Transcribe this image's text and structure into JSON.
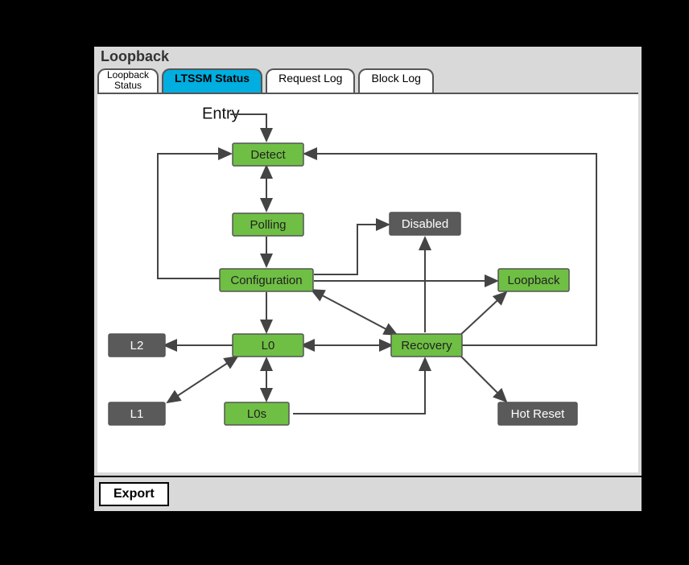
{
  "window": {
    "title": "Loopback"
  },
  "tabs": [
    {
      "label_line1": "Loopback",
      "label_line2": "Status",
      "active": false
    },
    {
      "label": "LTSSM Status",
      "active": true
    },
    {
      "label": "Request Log",
      "active": false
    },
    {
      "label": "Block Log",
      "active": false
    }
  ],
  "footer": {
    "export_label": "Export"
  },
  "diagram": {
    "entry_label": "Entry",
    "nodes": {
      "detect": {
        "label": "Detect",
        "color": "green"
      },
      "polling": {
        "label": "Polling",
        "color": "green"
      },
      "configuration": {
        "label": "Configuration",
        "color": "green"
      },
      "l0": {
        "label": "L0",
        "color": "green"
      },
      "l0s": {
        "label": "L0s",
        "color": "green"
      },
      "recovery": {
        "label": "Recovery",
        "color": "green"
      },
      "loopback": {
        "label": "Loopback",
        "color": "green"
      },
      "disabled": {
        "label": "Disabled",
        "color": "grey"
      },
      "l2": {
        "label": "L2",
        "color": "grey"
      },
      "l1": {
        "label": "L1",
        "color": "grey"
      },
      "hotreset": {
        "label": "Hot Reset",
        "color": "grey"
      }
    },
    "edges": [
      {
        "from": "Entry",
        "to": "Detect",
        "dir": "one"
      },
      {
        "from": "Detect",
        "to": "Polling",
        "dir": "both"
      },
      {
        "from": "Polling",
        "to": "Configuration",
        "dir": "one"
      },
      {
        "from": "Configuration",
        "to": "Detect",
        "dir": "one",
        "path": "wrap-left"
      },
      {
        "from": "Configuration",
        "to": "L0",
        "dir": "one"
      },
      {
        "from": "L0",
        "to": "L0s",
        "dir": "both"
      },
      {
        "from": "L0",
        "to": "L2",
        "dir": "one"
      },
      {
        "from": "L0",
        "to": "L1",
        "dir": "both"
      },
      {
        "from": "L0",
        "to": "Recovery",
        "dir": "both"
      },
      {
        "from": "Configuration",
        "to": "Recovery",
        "dir": "both"
      },
      {
        "from": "Configuration",
        "to": "Disabled",
        "dir": "one"
      },
      {
        "from": "Configuration",
        "to": "Loopback",
        "dir": "one"
      },
      {
        "from": "Recovery",
        "to": "Disabled",
        "dir": "one"
      },
      {
        "from": "Recovery",
        "to": "Loopback",
        "dir": "one"
      },
      {
        "from": "Recovery",
        "to": "Hot Reset",
        "dir": "one"
      },
      {
        "from": "Recovery",
        "to": "Detect",
        "dir": "one",
        "path": "wrap-right"
      },
      {
        "from": "L0s",
        "to": "Recovery",
        "dir": "one"
      }
    ]
  }
}
